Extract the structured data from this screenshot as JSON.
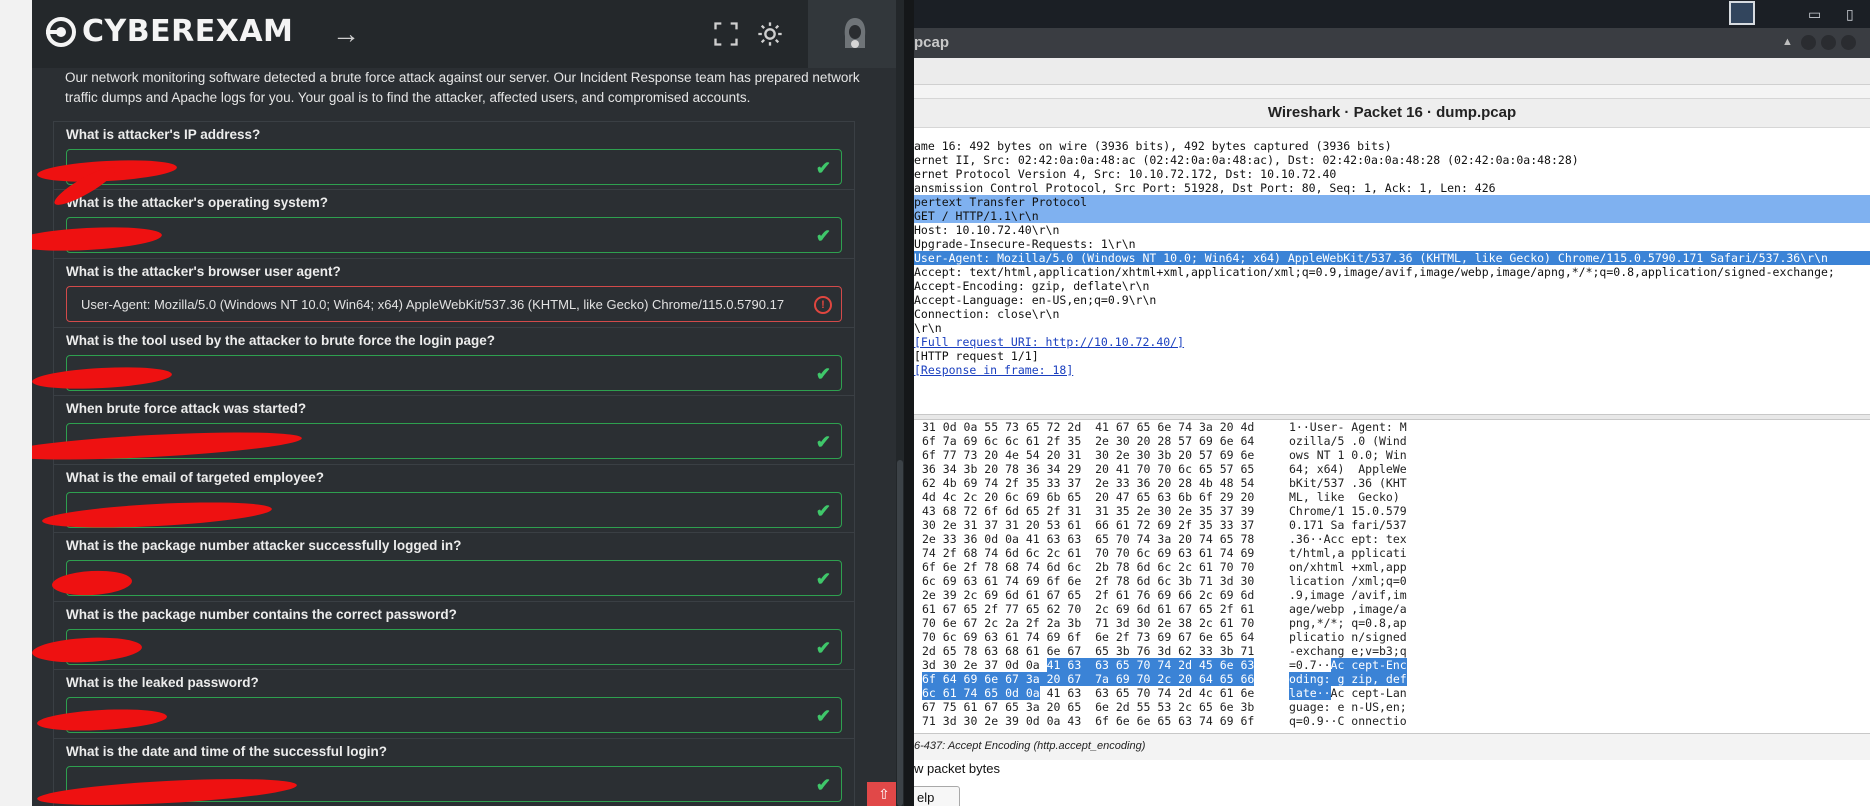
{
  "left": {
    "brand": "CYBEREXAM",
    "intro": "Our network monitoring software detected a brute force attack against our server. Our Incident Response team has prepared network traffic dumps and Apache logs for you. Your goal is to find the attacker, affected users, and compromised accounts.",
    "questions": [
      {
        "q": "What is attacker's IP address?",
        "value": ""
      },
      {
        "q": "What is the attacker's operating system?",
        "value": ""
      },
      {
        "q": "What is the attacker's browser user agent?",
        "value": "User-Agent: Mozilla/5.0 (Windows NT 10.0; Win64; x64) AppleWebKit/537.36 (KHTML, like Gecko) Chrome/115.0.5790.17"
      },
      {
        "q": "What is the tool used by the attacker to brute force the login page?",
        "value": ""
      },
      {
        "q": "When brute force attack was started?",
        "value": ""
      },
      {
        "q": "What is the email of targeted employee?",
        "value": ""
      },
      {
        "q": "What is the package number attacker successfully logged in?",
        "value": ""
      },
      {
        "q": "What is the package number contains the correct password?",
        "value": ""
      },
      {
        "q": "What is the leaked password?",
        "value": ""
      },
      {
        "q": "What is the date and time of the successful login?",
        "value": ""
      }
    ],
    "colors": {
      "accent_ok": "#3fc76a",
      "error": "#e0463f",
      "redaction": "#ee1111"
    }
  },
  "wireshark": {
    "window_title": "pcap",
    "dialog_title": "Wireshark · Packet 16 · dump.pcap",
    "tree": [
      {
        "text": "ame 16: 492 bytes on wire (3936 bits), 492 bytes captured (3936 bits)",
        "style": ""
      },
      {
        "text": "ernet II, Src: 02:42:0a:0a:48:ac (02:42:0a:0a:48:ac), Dst: 02:42:0a:0a:48:28 (02:42:0a:0a:48:28)",
        "style": ""
      },
      {
        "text": "ernet Protocol Version 4, Src: 10.10.72.172, Dst: 10.10.72.40",
        "style": ""
      },
      {
        "text": "ansmission Control Protocol, Src Port: 51928, Dst Port: 80, Seq: 1, Ack: 1, Len: 426",
        "style": ""
      },
      {
        "text": "pertext Transfer Protocol",
        "style": "sel"
      },
      {
        "text": "GET / HTTP/1.1\\r\\n",
        "style": "sel"
      },
      {
        "text": "Host: 10.10.72.40\\r\\n",
        "style": ""
      },
      {
        "text": "Upgrade-Insecure-Requests: 1\\r\\n",
        "style": ""
      },
      {
        "text": "User-Agent: Mozilla/5.0 (Windows NT 10.0; Win64; x64) AppleWebKit/537.36 (KHTML, like Gecko) Chrome/115.0.5790.171 Safari/537.36\\r\\n",
        "style": "selstrong"
      },
      {
        "text": "Accept: text/html,application/xhtml+xml,application/xml;q=0.9,image/avif,image/webp,image/apng,*/*;q=0.8,application/signed-exchange;",
        "style": ""
      },
      {
        "text": "Accept-Encoding: gzip, deflate\\r\\n",
        "style": ""
      },
      {
        "text": "Accept-Language: en-US,en;q=0.9\\r\\n",
        "style": ""
      },
      {
        "text": "Connection: close\\r\\n",
        "style": ""
      },
      {
        "text": "\\r\\n",
        "style": ""
      },
      {
        "text": "[Full request URI: http://10.10.72.40/]",
        "style": "link"
      },
      {
        "text": "[HTTP request 1/1]",
        "style": ""
      },
      {
        "text": "[Response in frame: 18]",
        "style": "link"
      }
    ],
    "hex": [
      {
        "h": "31 0d 0a 55 73 65 72 2d  41 67 65 6e 74 3a 20 4d",
        "a": "1··User- Agent: M"
      },
      {
        "h": "6f 7a 69 6c 6c 61 2f 35  2e 30 20 28 57 69 6e 64",
        "a": "ozilla/5 .0 (Wind"
      },
      {
        "h": "6f 77 73 20 4e 54 20 31  30 2e 30 3b 20 57 69 6e",
        "a": "ows NT 1 0.0; Win"
      },
      {
        "h": "36 34 3b 20 78 36 34 29  20 41 70 70 6c 65 57 65",
        "a": "64; x64)  AppleWe"
      },
      {
        "h": "62 4b 69 74 2f 35 33 37  2e 33 36 20 28 4b 48 54",
        "a": "bKit/537 .36 (KHT"
      },
      {
        "h": "4d 4c 2c 20 6c 69 6b 65  20 47 65 63 6b 6f 29 20",
        "a": "ML, like  Gecko)"
      },
      {
        "h": "43 68 72 6f 6d 65 2f 31  31 35 2e 30 2e 35 37 39",
        "a": "Chrome/1 15.0.579"
      },
      {
        "h": "30 2e 31 37 31 20 53 61  66 61 72 69 2f 35 33 37",
        "a": "0.171 Sa fari/537"
      },
      {
        "h": "2e 33 36 0d 0a 41 63 63  65 70 74 3a 20 74 65 78",
        "a": ".36··Acc ept: tex"
      },
      {
        "h": "74 2f 68 74 6d 6c 2c 61  70 70 6c 69 63 61 74 69",
        "a": "t/html,a pplicati"
      },
      {
        "h": "6f 6e 2f 78 68 74 6d 6c  2b 78 6d 6c 2c 61 70 70",
        "a": "on/xhtml +xml,app"
      },
      {
        "h": "6c 69 63 61 74 69 6f 6e  2f 78 6d 6c 3b 71 3d 30",
        "a": "lication /xml;q=0"
      },
      {
        "h": "2e 39 2c 69 6d 61 67 65  2f 61 76 69 66 2c 69 6d",
        "a": ".9,image /avif,im"
      },
      {
        "h": "61 67 65 2f 77 65 62 70  2c 69 6d 61 67 65 2f 61",
        "a": "age/webp ,image/a"
      },
      {
        "h": "70 6e 67 2c 2a 2f 2a 3b  71 3d 30 2e 38 2c 61 70",
        "a": "png,*/*; q=0.8,ap"
      },
      {
        "h": "70 6c 69 63 61 74 69 6f  6e 2f 73 69 67 6e 65 64",
        "a": "plicatio n/signed"
      },
      {
        "h": "2d 65 78 63 68 61 6e 67  65 3b 76 3d 62 33 3b 71",
        "a": "-exchang e;v=b3;q"
      }
    ],
    "hex_sel": [
      {
        "h1": "3d 30 2e 37 0d 0a ",
        "h2": "41 63  63 65 70 74 2d 45 6e 63",
        "a1": "=0.7··",
        "a2": "Ac cept-Enc"
      },
      {
        "h1": "",
        "h2": "6f 64 69 6e 67 3a 20 67  7a 69 70 2c 20 64 65 66",
        "a1": "",
        "a2": "oding: g zip, def"
      },
      {
        "h1": "",
        "h2": "6c 61 74 65 0d 0a",
        "h3": " 41 63  63 65 70 74 2d 4c 61 6e",
        "a1": "",
        "a2": "late··",
        "a3": "Ac cept-Lan"
      }
    ],
    "hex_tail": [
      {
        "h": "67 75 61 67 65 3a 20 65  6e 2d 55 53 2c 65 6e 3b",
        "a": "guage: e n-US,en;"
      },
      {
        "h": "71 3d 30 2e 39 0d 0a 43  6f 6e 6e 65 63 74 69 6f",
        "a": "q=0.9··C onnectio"
      }
    ],
    "status": "6-437: Accept Encoding (http.accept_encoding)",
    "show_bytes": "w packet bytes",
    "help": "elp"
  }
}
